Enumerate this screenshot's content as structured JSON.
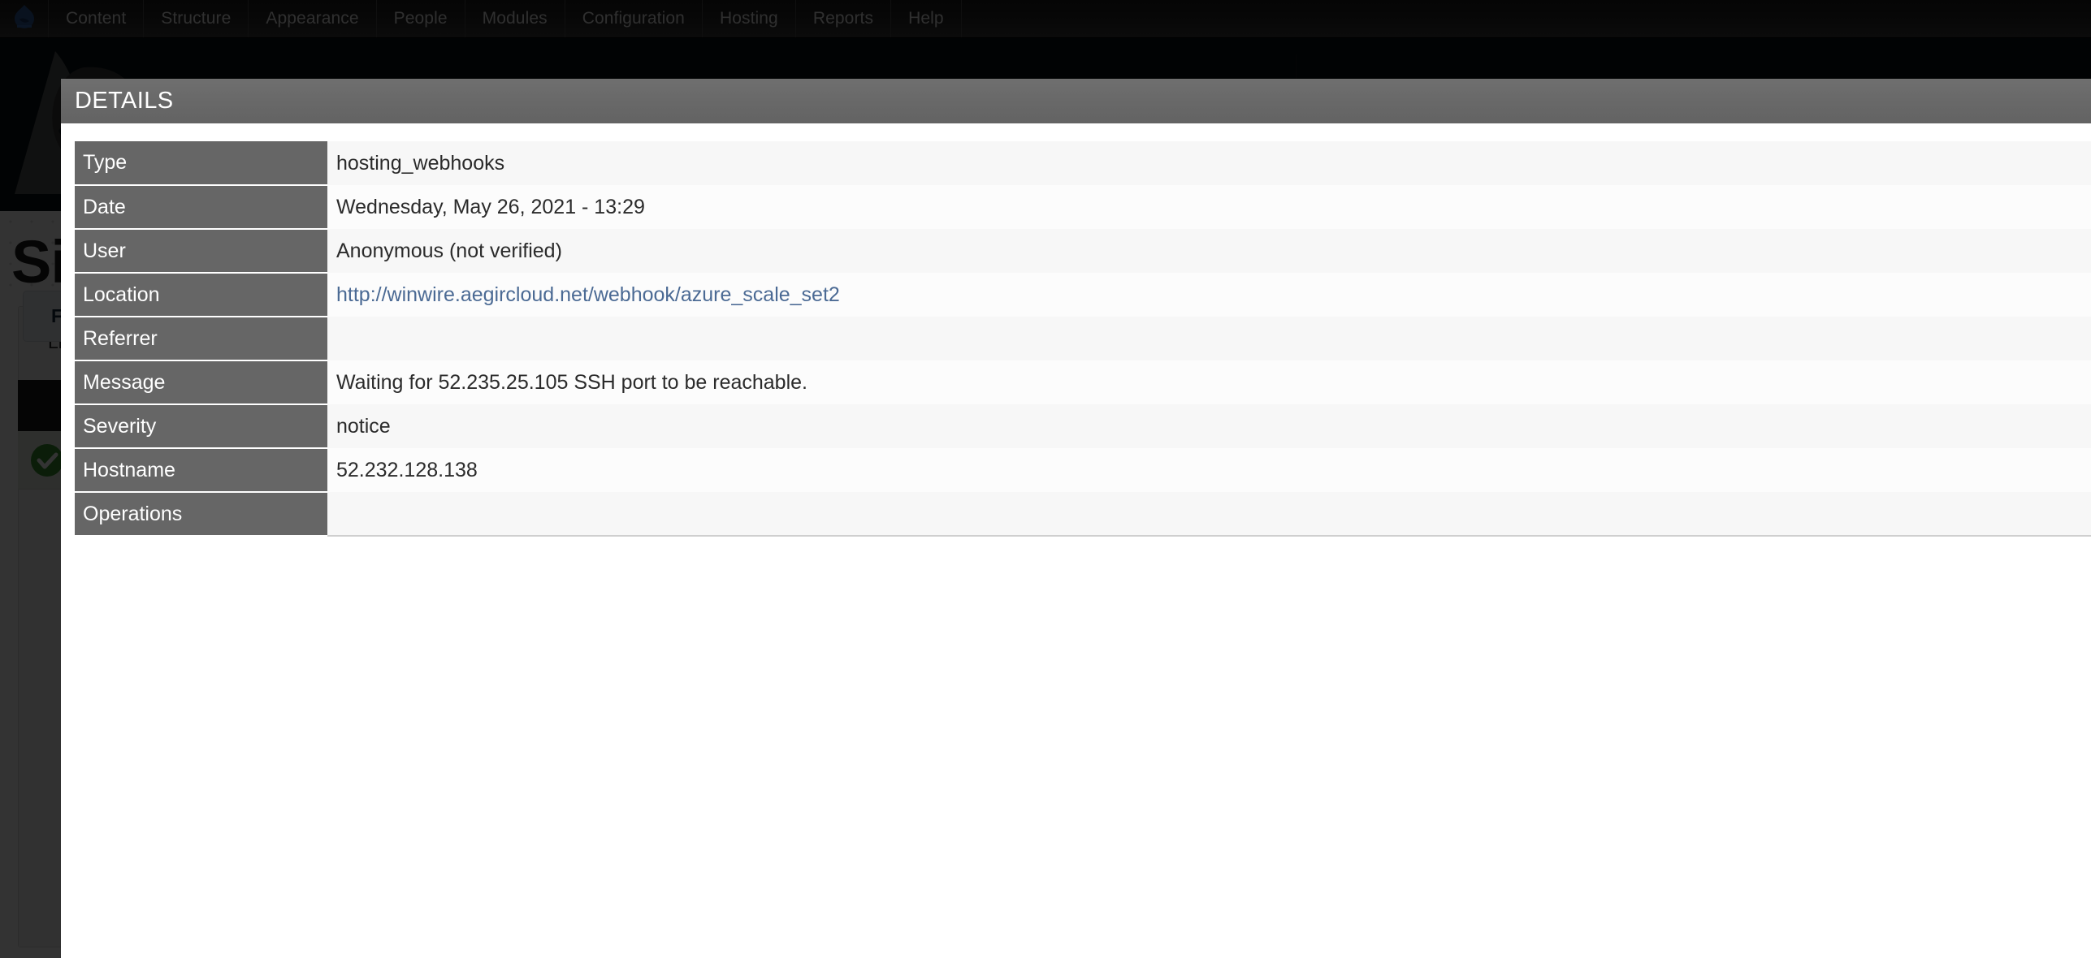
{
  "toolbar": {
    "home_icon": "drupal-logo-icon",
    "items": [
      {
        "label": "Content"
      },
      {
        "label": "Structure"
      },
      {
        "label": "Appearance"
      },
      {
        "label": "People"
      },
      {
        "label": "Modules"
      },
      {
        "label": "Configuration"
      },
      {
        "label": "Hosting"
      },
      {
        "label": "Reports"
      },
      {
        "label": "Help"
      }
    ]
  },
  "background": {
    "logo_icon": "aegir-wave-logo-icon",
    "page_title": "Sites",
    "tabs": [
      {
        "label": "List"
      }
    ],
    "filter_button": "Filter",
    "status_icon": "success-check-icon"
  },
  "modal": {
    "title": "DETAILS",
    "rows": [
      {
        "label": "Type",
        "value": "hosting_webhooks",
        "is_link": false
      },
      {
        "label": "Date",
        "value": "Wednesday, May 26, 2021 - 13:29",
        "is_link": false
      },
      {
        "label": "User",
        "value": "Anonymous (not verified)",
        "is_link": false
      },
      {
        "label": "Location",
        "value": "http://winwire.aegircloud.net/webhook/azure_scale_set2",
        "is_link": true
      },
      {
        "label": "Referrer",
        "value": "",
        "is_link": false
      },
      {
        "label": "Message",
        "value": "Waiting for 52.235.25.105 SSH port to be reachable.",
        "is_link": false
      },
      {
        "label": "Severity",
        "value": "notice",
        "is_link": false
      },
      {
        "label": "Hostname",
        "value": "52.232.128.138",
        "is_link": false
      },
      {
        "label": "Operations",
        "value": "",
        "is_link": false
      }
    ]
  },
  "colors": {
    "toolbar_bg": "#242424",
    "site_band_bg": "#080f17",
    "modal_header_bg": "#686868",
    "label_cell_bg": "#666666",
    "value_cell_bg": "#f7f7f7",
    "link_color": "#4b6a94",
    "logo_blue": "#2f5a9c",
    "success_green": "#37902f"
  }
}
